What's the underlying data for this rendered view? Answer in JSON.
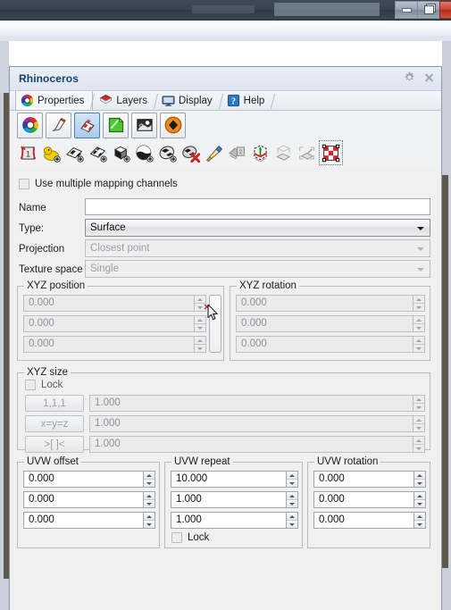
{
  "window": {
    "buttons": [
      {
        "name": "minimize",
        "glyph": "minimize-icon"
      },
      {
        "name": "restore",
        "glyph": "restore-icon"
      },
      {
        "name": "close",
        "glyph": "close-icon"
      }
    ]
  },
  "panel": {
    "title": "Rhinoceros",
    "header_icons": [
      {
        "name": "gear-icon",
        "label": "⚙"
      },
      {
        "name": "close-icon",
        "label": "×"
      }
    ],
    "tabs": [
      {
        "label": "Properties",
        "icon": "color-wheel-icon",
        "active": true
      },
      {
        "label": "Layers",
        "icon": "layers-icon",
        "active": false
      },
      {
        "label": "Display",
        "icon": "monitor-icon",
        "active": false
      },
      {
        "label": "Help",
        "icon": "help-icon",
        "active": false
      }
    ],
    "category_buttons": [
      {
        "name": "object-properties-icon",
        "selected": false
      },
      {
        "name": "material-brush-icon",
        "selected": false
      },
      {
        "name": "texture-mapping-icon",
        "selected": true
      },
      {
        "name": "display-color-icon",
        "selected": false
      },
      {
        "name": "environment-icon",
        "selected": false
      },
      {
        "name": "object-icon",
        "selected": false
      }
    ],
    "mapping_toolbar": [
      {
        "name": "show-mapping-icon",
        "selected": false
      },
      {
        "name": "apply-custom-mapping-icon",
        "selected": false
      },
      {
        "name": "add-planar-mapping-icon",
        "selected": false
      },
      {
        "name": "add-planar-mapping-alt-icon",
        "selected": false
      },
      {
        "name": "add-box-mapping-icon",
        "selected": false
      },
      {
        "name": "add-sphere-mapping-icon",
        "selected": false
      },
      {
        "name": "add-cylinder-mapping-icon",
        "selected": false
      },
      {
        "name": "remove-mapping-icon",
        "selected": false
      },
      {
        "name": "match-mapping-icon",
        "selected": false
      },
      {
        "name": "copy-mapping-icon",
        "selected": false
      },
      {
        "name": "mapping-widget-icon",
        "selected": false
      },
      {
        "name": "unwrap-icon",
        "selected": false
      },
      {
        "name": "unwrap-alt-icon",
        "selected": false
      },
      {
        "name": "show-uv-editor-icon",
        "selected": true
      }
    ]
  },
  "form": {
    "use_multiple_channels": {
      "label": "Use multiple mapping channels",
      "checked": false,
      "enabled": true
    },
    "name": {
      "label": "Name",
      "value": "",
      "placeholder": "",
      "enabled": true
    },
    "type": {
      "label": "Type:",
      "value": "Surface",
      "enabled": true
    },
    "projection": {
      "label": "Projection",
      "value": "Closest point",
      "enabled": false
    },
    "texture_space": {
      "label": "Texture space",
      "value": "Single",
      "enabled": false
    }
  },
  "xyz_position": {
    "caption": "XYZ position",
    "enabled": false,
    "fields": [
      "0.000",
      "0.000",
      "0.000"
    ],
    "side_button": "mapping-widget-toggle"
  },
  "xyz_rotation": {
    "caption": "XYZ rotation",
    "enabled": false,
    "fields": [
      "0.000",
      "0.000",
      "0.000"
    ]
  },
  "xyz_size": {
    "caption": "XYZ size",
    "enabled": false,
    "lock": {
      "label": "Lock",
      "checked": false
    },
    "buttons": [
      "1,1,1",
      "x=y=z",
      ">[ ]<"
    ],
    "fields": [
      "1.000",
      "1.000",
      "1.000"
    ]
  },
  "uvw_offset": {
    "caption": "UVW offset",
    "enabled": true,
    "fields": [
      "0.000",
      "0.000",
      "0.000"
    ]
  },
  "uvw_repeat": {
    "caption": "UVW repeat",
    "enabled": true,
    "fields": [
      "10.000",
      "1.000",
      "1.000"
    ],
    "lock": {
      "label": "Lock",
      "checked": false
    }
  },
  "uvw_rotation": {
    "caption": "UVW rotation",
    "enabled": true,
    "fields": [
      "0.000",
      "0.000",
      "0.000"
    ]
  },
  "colors": {
    "panel_bg": "#f0f0f0",
    "title_text": "#15406b",
    "selection": "#a9cbec",
    "disabled_text": "#8e9299",
    "group_border": "#b6bcc2"
  }
}
